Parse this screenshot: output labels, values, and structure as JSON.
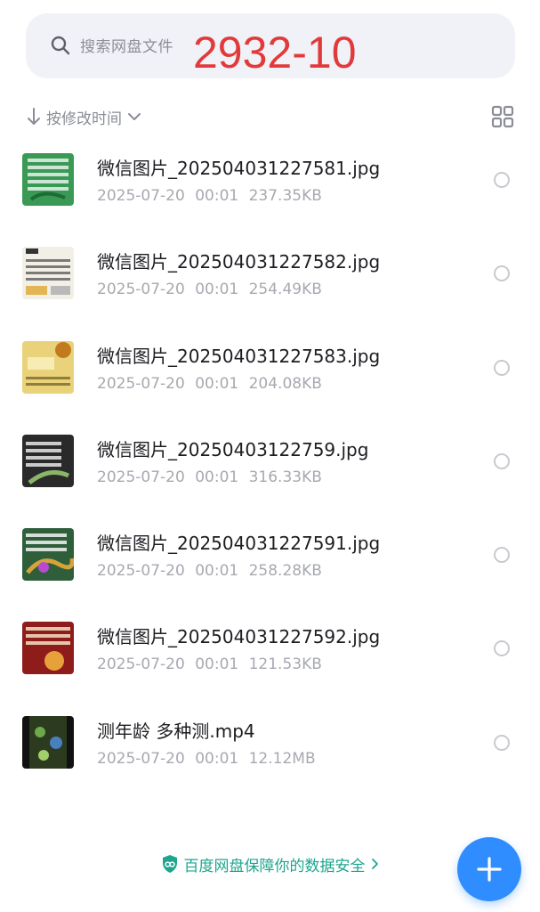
{
  "search": {
    "placeholder": "搜索网盘文件"
  },
  "overlay_number": "2932-10",
  "sort": {
    "label": "按修改时间"
  },
  "files": [
    {
      "name": "微信图片_202504031227581.jpg",
      "date": "2025-07-20",
      "time": "00:01",
      "size": "237.35KB",
      "thumb_color": "#3a9a55"
    },
    {
      "name": "微信图片_202504031227582.jpg",
      "date": "2025-07-20",
      "time": "00:01",
      "size": "254.49KB",
      "thumb_color": "#f2efe6"
    },
    {
      "name": "微信图片_202504031227583.jpg",
      "date": "2025-07-20",
      "time": "00:01",
      "size": "204.08KB",
      "thumb_color": "#e9d27a"
    },
    {
      "name": "微信图片_20250403122759.jpg",
      "date": "2025-07-20",
      "time": "00:01",
      "size": "316.33KB",
      "thumb_color": "#2a2a2a"
    },
    {
      "name": "微信图片_202504031227591.jpg",
      "date": "2025-07-20",
      "time": "00:01",
      "size": "258.28KB",
      "thumb_color": "#2e5e3a"
    },
    {
      "name": "微信图片_202504031227592.jpg",
      "date": "2025-07-20",
      "time": "00:01",
      "size": "121.53KB",
      "thumb_color": "#8e1c1a"
    },
    {
      "name": "测年龄 多种测.mp4",
      "date": "2025-07-20",
      "time": "00:01",
      "size": "12.12MB",
      "thumb_color": "#2c3a20"
    }
  ],
  "footer": {
    "notice": "百度网盘保障你的数据安全"
  },
  "colors": {
    "accent": "#2f8dff",
    "notice": "#1ea58e",
    "overlay": "#e23a3a"
  },
  "icons": [
    "search-icon",
    "sort-arrow-icon",
    "chevron-down-icon",
    "grid-view-icon",
    "shield-icon",
    "chevron-right-icon",
    "plus-icon"
  ]
}
